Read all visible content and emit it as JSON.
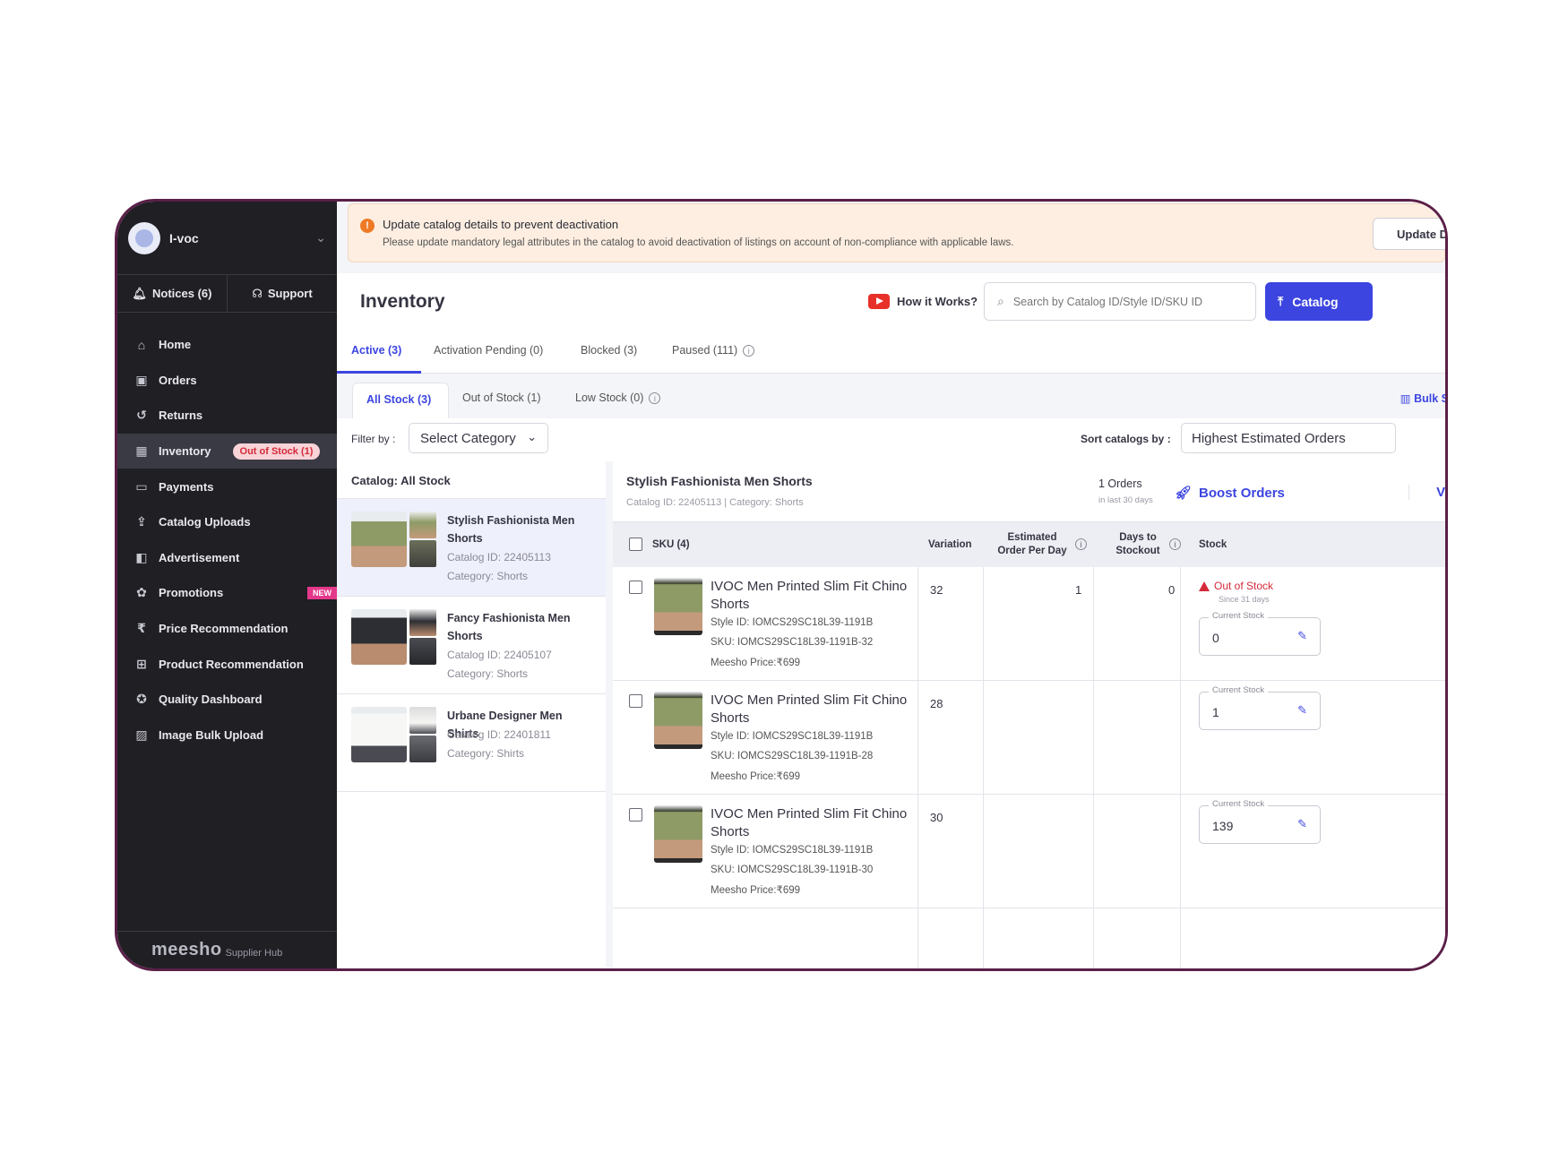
{
  "sidebar": {
    "org_name": "I-voc",
    "notices": "Notices (6)",
    "support": "Support",
    "items": [
      {
        "label": "Home",
        "icon": "home-icon"
      },
      {
        "label": "Orders",
        "icon": "orders-icon"
      },
      {
        "label": "Returns",
        "icon": "returns-icon"
      },
      {
        "label": "Inventory",
        "icon": "inventory-icon",
        "badge": "Out of Stock (1)"
      },
      {
        "label": "Payments",
        "icon": "payments-icon"
      },
      {
        "label": "Catalog Uploads",
        "icon": "upload-icon"
      },
      {
        "label": "Advertisement",
        "icon": "megaphone-icon"
      },
      {
        "label": "Promotions",
        "icon": "promotions-icon",
        "badge": "NEW"
      },
      {
        "label": "Price Recommendation",
        "icon": "price-icon"
      },
      {
        "label": "Product Recommendation",
        "icon": "product-icon"
      },
      {
        "label": "Quality Dashboard",
        "icon": "quality-icon"
      },
      {
        "label": "Image Bulk Upload",
        "icon": "image-icon"
      }
    ],
    "brand": "meesho",
    "brand_sub": "Supplier Hub"
  },
  "banner": {
    "title": "Update catalog details to prevent deactivation",
    "text": "Please update mandatory legal attributes in the catalog to avoid deactivation of listings on account of non-compliance with applicable laws.",
    "button": "Update De"
  },
  "header": {
    "title": "Inventory",
    "how_it_works": "How it Works?",
    "search_placeholder": "Search by Catalog ID/Style ID/SKU ID",
    "catalog_button": "Catalog"
  },
  "status_tabs": [
    "Active (3)",
    "Activation Pending (0)",
    "Blocked (3)",
    "Paused (111)"
  ],
  "stock_tabs": [
    "All Stock (3)",
    "Out of Stock (1)",
    "Low Stock (0)"
  ],
  "bulk_label": "Bulk S",
  "filter": {
    "label": "Filter by :",
    "value": "Select Category",
    "sort_label": "Sort catalogs by :",
    "sort_value": "Highest Estimated Orders"
  },
  "catalog_list": {
    "header": "Catalog: All Stock",
    "items": [
      {
        "name": "Stylish Fashionista Men Shorts",
        "catalog_id": "Catalog ID: 22405113",
        "category": "Category: Shorts"
      },
      {
        "name": "Fancy Fashionista Men Shorts",
        "catalog_id": "Catalog ID: 22405107",
        "category": "Category: Shorts"
      },
      {
        "name": "Urbane Designer Men Shirts",
        "catalog_id": "Catalog ID: 22401811",
        "category": "Category: Shirts"
      }
    ]
  },
  "detail": {
    "title": "Stylish Fashionista Men Shorts",
    "subtitle": "Catalog ID: 22405113 | Category: Shorts",
    "orders": "1 Orders",
    "orders_sub": "in last 30 days",
    "boost": "Boost Orders",
    "view": "Vi",
    "columns": {
      "sku": "SKU (4)",
      "variation": "Variation",
      "est_orders": "Estimated Order Per Day",
      "days_stockout": "Days to Stockout",
      "stock": "Stock"
    },
    "stock_label": "Current Stock",
    "rows": [
      {
        "name": "IVOC Men Printed Slim Fit Chino Shorts",
        "style_id": "Style ID: IOMCS29SC18L39-1191B",
        "sku": "SKU: IOMCS29SC18L39-1191B-32",
        "price": "Meesho Price:₹699",
        "variation": "32",
        "est": "1",
        "days": "0",
        "oos": "Out of Stock",
        "oos_since": "Since 31 days",
        "stock": "0"
      },
      {
        "name": "IVOC Men Printed Slim Fit Chino Shorts",
        "style_id": "Style ID: IOMCS29SC18L39-1191B",
        "sku": "SKU: IOMCS29SC18L39-1191B-28",
        "price": "Meesho Price:₹699",
        "variation": "28",
        "est": "",
        "days": "",
        "stock": "1"
      },
      {
        "name": "IVOC Men Printed Slim Fit Chino Shorts",
        "style_id": "Style ID: IOMCS29SC18L39-1191B",
        "sku": "SKU: IOMCS29SC18L39-1191B-30",
        "price": "Meesho Price:₹699",
        "variation": "30",
        "est": "",
        "days": "",
        "stock": "139"
      }
    ]
  },
  "colors": {
    "accent": "#3c45e0",
    "sidebar_bg": "#1f1f24",
    "danger": "#d42a3a",
    "banner_bg": "#fdeee1",
    "frame": "#5a1f48"
  }
}
